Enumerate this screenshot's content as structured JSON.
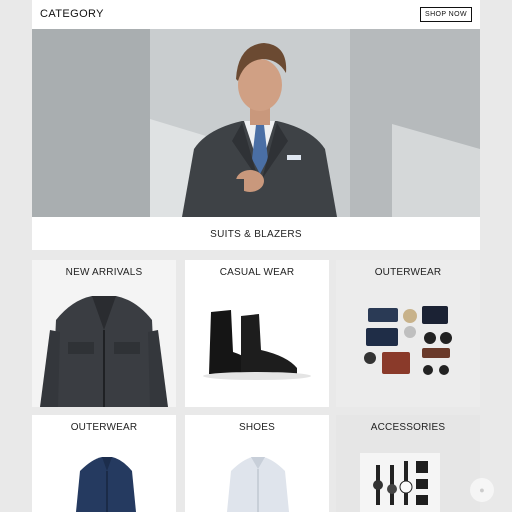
{
  "header": {
    "title": "CATEGORY",
    "cta_label": "SHOP NOW"
  },
  "hero": {
    "caption": "SUITS & BLAZERS"
  },
  "cards": [
    {
      "label": "NEW ARRIVALS"
    },
    {
      "label": "CASUAL WEAR"
    },
    {
      "label": "OUTERWEAR"
    },
    {
      "label": "OUTERWEAR"
    },
    {
      "label": "SHOES"
    },
    {
      "label": "ACCESSORIES"
    }
  ]
}
